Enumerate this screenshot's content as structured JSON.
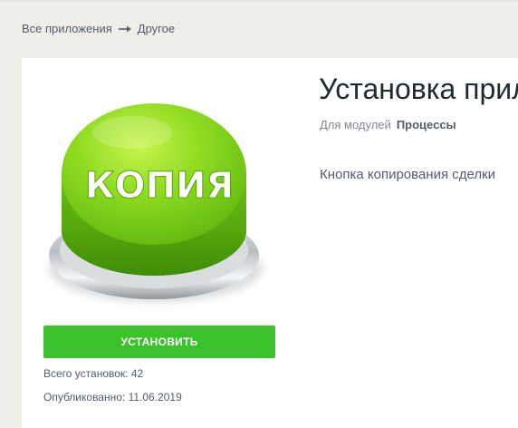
{
  "breadcrumb": {
    "items": [
      "Все приложения",
      "Другое"
    ],
    "separator_icon": "arrow-right-icon"
  },
  "app": {
    "title": "Установка приложения",
    "module_prefix": "Для модулей",
    "module_name": "Процессы",
    "description": "Кнопка копирования сделки",
    "image_label": "КОПИЯ",
    "install_label": "УСТАНОВИТЬ",
    "installs_text": "Всего установок: 42",
    "published_text": "Опубликованно: 11.06.2019"
  },
  "colors": {
    "page_bg": "#efeee9",
    "card_bg": "#ffffff",
    "install_button": "#3bc12a",
    "button_green": "#7ed321"
  }
}
